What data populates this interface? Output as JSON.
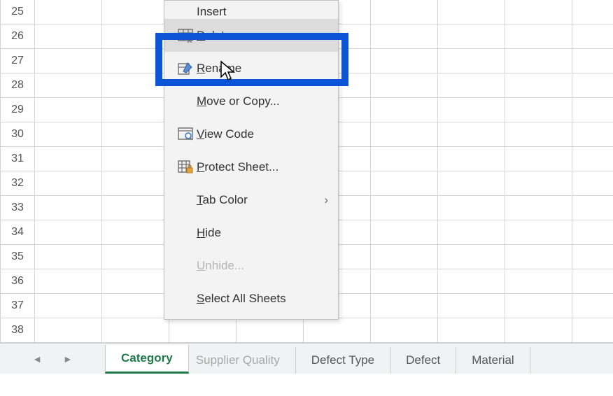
{
  "rows": [
    25,
    26,
    27,
    28,
    29,
    30,
    31,
    32,
    33,
    34,
    35,
    36,
    37,
    38
  ],
  "menu": {
    "insert": "Insert",
    "delete": "Delete",
    "rename": "Rename",
    "move": "Move or Copy...",
    "view": "View Code",
    "protect": "Protect Sheet...",
    "tabcolor": "Tab Color",
    "hide": "Hide",
    "unhide": "Unhide...",
    "select": "Select All Sheets"
  },
  "tabs": {
    "active": "Category",
    "partial": "Supplier Quality",
    "t3": "Defect Type",
    "t4": "Defect",
    "t5": "Material"
  },
  "nav": {
    "prev": "◄",
    "next": "►"
  },
  "submenu_arrow": "›"
}
